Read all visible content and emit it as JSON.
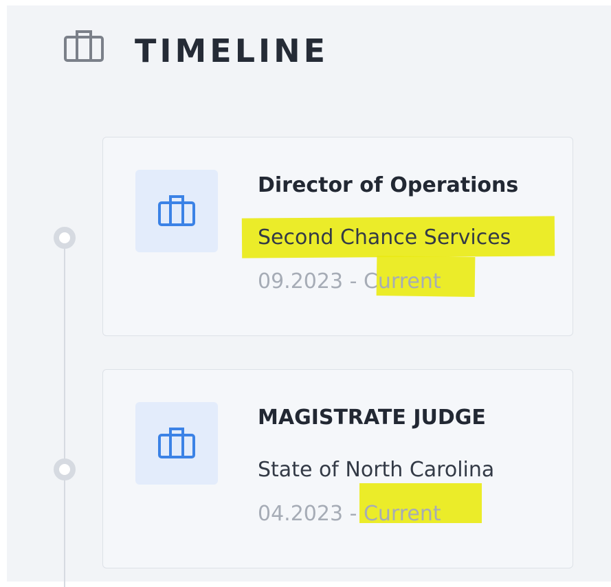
{
  "header": {
    "icon": "briefcase-icon",
    "title": "TIMELINE"
  },
  "entries": [
    {
      "icon": "briefcase-icon",
      "title": "Director of Operations",
      "organization": "Second Chance Services",
      "dates": "09.2023 - Current"
    },
    {
      "icon": "briefcase-icon",
      "title": "MAGISTRATE JUDGE",
      "organization": "State of North Carolina",
      "dates": "04.2023 - Current"
    }
  ],
  "colors": {
    "panel_background": "#f2f4f7",
    "title_text": "#252b36",
    "icon_blue": "#3b82e6",
    "icon_box": "#e3ecfb",
    "muted_text": "#a6acb6",
    "highlight": "#eaea12",
    "timeline": "#d6dae1"
  }
}
